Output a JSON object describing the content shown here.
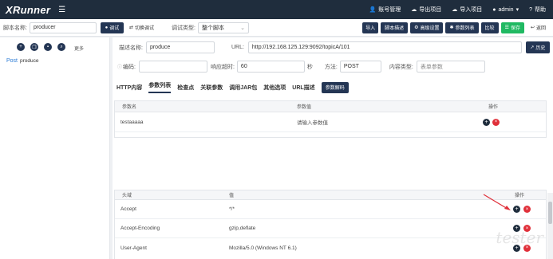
{
  "app": {
    "brand": "XRunner",
    "menu_icon": "hamburger-icon"
  },
  "topnav": [
    {
      "label": "账号管理",
      "icon": "user-icon"
    },
    {
      "label": "导出项目",
      "icon": "cloud-download-icon"
    },
    {
      "label": "导入项目",
      "icon": "cloud-upload-icon"
    },
    {
      "label": "admin",
      "icon": "avatar-icon",
      "caret": "▾"
    },
    {
      "label": "帮助",
      "icon": "help-icon"
    }
  ],
  "toolbar": {
    "script_name_label": "脚本名称:",
    "script_name_value": "producer",
    "debug_button": "调试",
    "switch_debug": "切换调试",
    "debug_type_label": "调试类型:",
    "debug_type_value": "整个脚本",
    "buttons": [
      "导入",
      "脚本描述",
      "高级设置",
      "参数列表",
      "比较",
      "保存",
      "返回"
    ]
  },
  "sidebar": {
    "more_label": "更多",
    "tree_item_method": "Post",
    "tree_item_name": "produce"
  },
  "form": {
    "desc_label": "描述名称:",
    "desc_value": "produce",
    "url_label": "URL:",
    "url_value": "http://192.168.125.129:9092/topicA/101",
    "history_button": "历史",
    "encoding_label": "编码:",
    "encoding_value": "",
    "timeout_label": "响应超时:",
    "timeout_value": "60",
    "timeout_unit": "秒",
    "method_label": "方法:",
    "method_value": "POST",
    "content_type_label": "内容类型:",
    "content_type_placeholder": "表单参数"
  },
  "tabs": [
    "HTTP内容",
    "参数列表",
    "检查点",
    "关联参数",
    "调用JAR包",
    "其他选项",
    "URL描述"
  ],
  "active_tab": "参数列表",
  "param_decode_button": "参数解码",
  "params_table": {
    "headers": [
      "参数名",
      "参数值",
      "操作"
    ],
    "rows": [
      {
        "name": "testaaaaa",
        "value": "请输入参数值"
      }
    ]
  },
  "headers_table": {
    "headers": [
      "头域",
      "值",
      "操作"
    ],
    "rows": [
      {
        "name": "Accept",
        "value": "*/*"
      },
      {
        "name": "Accept-Encoding",
        "value": "gzip,deflate"
      },
      {
        "name": "User-Agent",
        "value": "Mozilla/5.0 (Windows NT 6.1)"
      }
    ]
  },
  "watermark": "tester",
  "colors": {
    "topbar": "#1f2d3d",
    "accent": "#243654",
    "save": "#20b962",
    "delete": "#e0303a",
    "arrow": "#e0303a"
  }
}
